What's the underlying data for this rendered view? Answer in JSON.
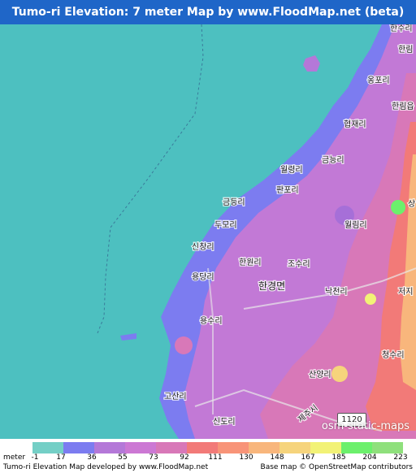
{
  "title": "Tumo-ri Elevation: 7 meter Map by www.FloodMap.net (beta)",
  "colors": {
    "title_bg": "#1f66c8",
    "sea": "#4dc0c0",
    "legend": [
      "#74cfc6",
      "#7c7cf0",
      "#b478d8",
      "#cc78d4",
      "#d878b8",
      "#f27a78",
      "#f89478",
      "#f8b67c",
      "#f6d47c",
      "#f2f276",
      "#6cf06c",
      "#8fe07c"
    ]
  },
  "map": {
    "place_labels": [
      "한수리",
      "한림",
      "옹포리",
      "한림읍",
      "협재리",
      "금능리",
      "월령리",
      "판포리",
      "금등리",
      "두모리",
      "신창리",
      "한원리",
      "조수리",
      "용당리",
      "한경면",
      "낙천리",
      "저지",
      "용수리",
      "월림리",
      "청수리",
      "산양리",
      "고산리",
      "신도리",
      "상"
    ],
    "district_label": "한경면",
    "road_number": "1120",
    "road_name": "제주시",
    "watermark": "osm-static-maps"
  },
  "legend": {
    "unit": "meter",
    "ticks": [
      "-1",
      "17",
      "36",
      "55",
      "73",
      "92",
      "111",
      "130",
      "148",
      "167",
      "185",
      "204",
      "223"
    ]
  },
  "footer": {
    "left": "Tumo-ri Elevation Map developed by www.FloodMap.net",
    "right": "Base map © OpenStreetMap contributors"
  }
}
